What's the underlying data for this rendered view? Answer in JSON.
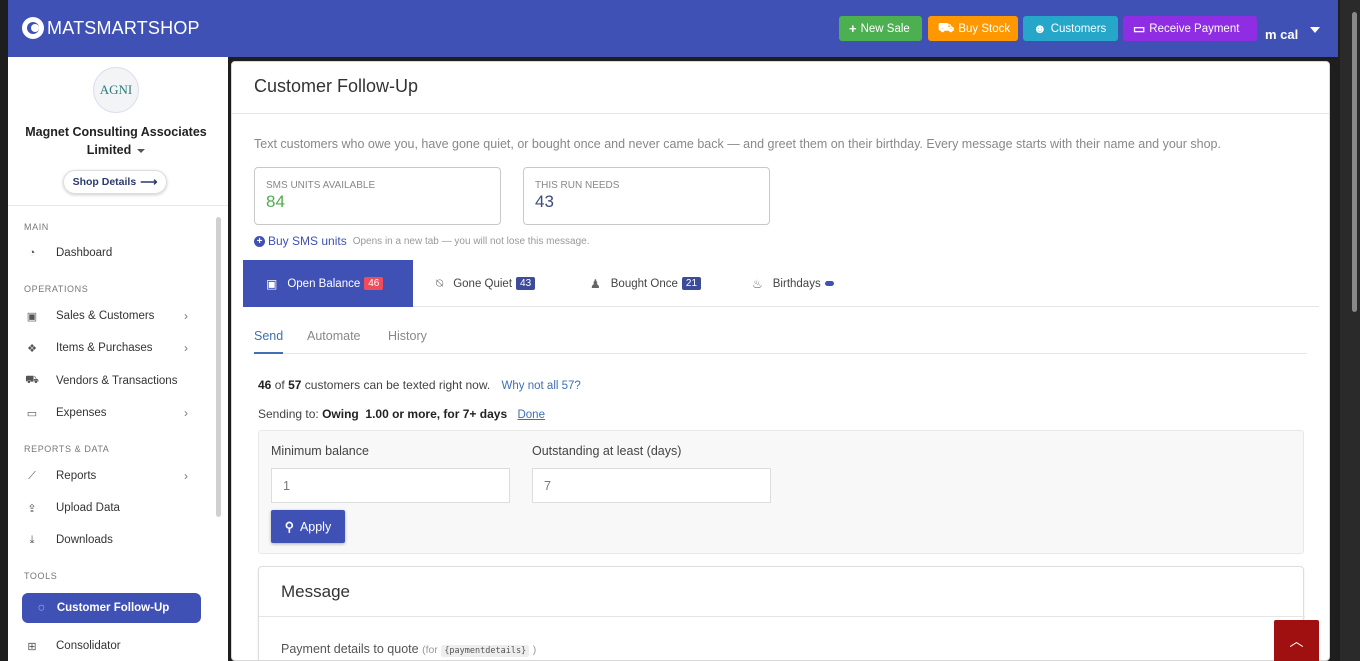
{
  "header": {
    "brand": "MATSMARTSHOP",
    "buttons": {
      "new_sale": "New Sale",
      "buy_stock": "Buy Stock",
      "customers": "Customers",
      "receive_payment": "Receive Payment"
    },
    "user": "m cal"
  },
  "sidebar": {
    "org_logo_text": "AGNI",
    "org_name": "Magnet Consulting Associates Limited",
    "shop_details": "Shop Details",
    "sections": {
      "main": "MAIN",
      "operations": "OPERATIONS",
      "reports": "REPORTS & DATA",
      "tools": "TOOLS"
    },
    "items": {
      "dashboard": "Dashboard",
      "sales_customers": "Sales & Customers",
      "items_purchases": "Items & Purchases",
      "vendors": "Vendors & Transactions",
      "expenses": "Expenses",
      "reports": "Reports",
      "upload": "Upload Data",
      "downloads": "Downloads",
      "followup": "Customer Follow-Up",
      "consolidator": "Consolidator"
    }
  },
  "main": {
    "title": "Customer Follow-Up",
    "intro": "Text customers who owe you, have gone quiet, or bought once and never came back — and greet them on their birthday. Every message starts with their name and your shop.",
    "units": {
      "available_label": "SMS UNITS AVAILABLE",
      "available_value": "84",
      "needs_label": "THIS RUN NEEDS",
      "needs_value": "43"
    },
    "buy_sms": "Buy SMS units",
    "buy_note": "Opens in a new tab — you will not lose this message.",
    "segments": [
      {
        "label": "Open Balance",
        "count": "46"
      },
      {
        "label": "Gone Quiet",
        "count": "43"
      },
      {
        "label": "Bought Once",
        "count": "21"
      },
      {
        "label": "Birthdays"
      }
    ],
    "subtabs": {
      "send": "Send",
      "automate": "Automate",
      "history": "History"
    },
    "count_line": {
      "can": "46",
      "of_word": "of",
      "total": "57",
      "rest": "customers can be texted right now.",
      "why": "Why not all 57?"
    },
    "sending_to": {
      "prefix": "Sending to:",
      "criteria": "Owing  1.00 or more, for 7+ days",
      "done": "Done"
    },
    "filters": {
      "min_balance_label": "Minimum balance",
      "min_balance_value": "1",
      "days_label": "Outstanding at least (days)",
      "days_value": "7",
      "apply": "Apply"
    },
    "message": {
      "title": "Message",
      "payment_label": "Payment details to quote",
      "for_text": "(for",
      "token": "{paymentdetails}",
      "close_paren": ")"
    }
  },
  "colors": {
    "primary": "#3f51b5",
    "green": "#4caf50",
    "orange": "#ff9800",
    "teal": "#26a6c8",
    "purple": "#8e2de2",
    "badge_red": "#f04d5c",
    "scrolltop": "#a01010"
  }
}
